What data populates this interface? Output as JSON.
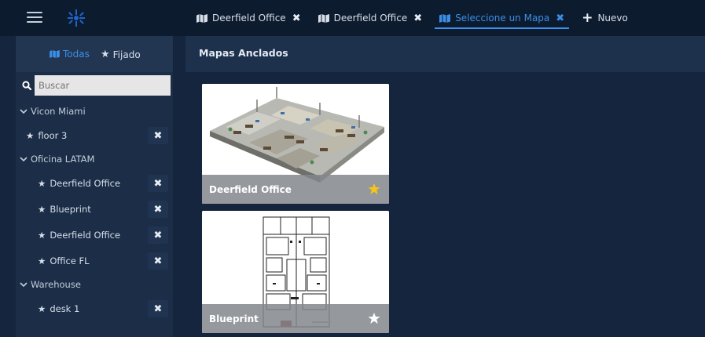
{
  "topbar": {
    "menu_icon": "hamburger-icon",
    "logo_icon": "app-logo-icon",
    "tabs": [
      {
        "label": "Deerfield Office",
        "icon": "map-icon",
        "active": false
      },
      {
        "label": "Deerfield Office",
        "icon": "map-icon",
        "active": false
      },
      {
        "label": "Seleccione un Mapa",
        "icon": "map-icon",
        "active": true
      }
    ],
    "new_tab_label": "Nuevo"
  },
  "sidebar": {
    "filter_all_label": "Todas",
    "filter_pinned_label": "Fijado",
    "search": {
      "value": "",
      "placeholder": "Buscar"
    },
    "groups": [
      {
        "label": "Vicon Miami",
        "items": [
          {
            "label": "floor 3"
          }
        ]
      },
      {
        "label": "Oficina LATAM",
        "items": [
          {
            "label": "Deerfield Office"
          },
          {
            "label": "Blueprint"
          },
          {
            "label": "Deerfield Office"
          },
          {
            "label": "Office FL"
          }
        ]
      },
      {
        "label": "Warehouse",
        "items": [
          {
            "label": "desk 1"
          }
        ]
      }
    ]
  },
  "main": {
    "title": "Mapas Anclados",
    "cards": [
      {
        "name": "Deerfield Office",
        "pinned": true
      },
      {
        "name": "Blueprint",
        "pinned": false
      }
    ]
  },
  "colors": {
    "accent": "#3a8fe8",
    "pin_active": "#f5c518",
    "background": "#14253d"
  }
}
